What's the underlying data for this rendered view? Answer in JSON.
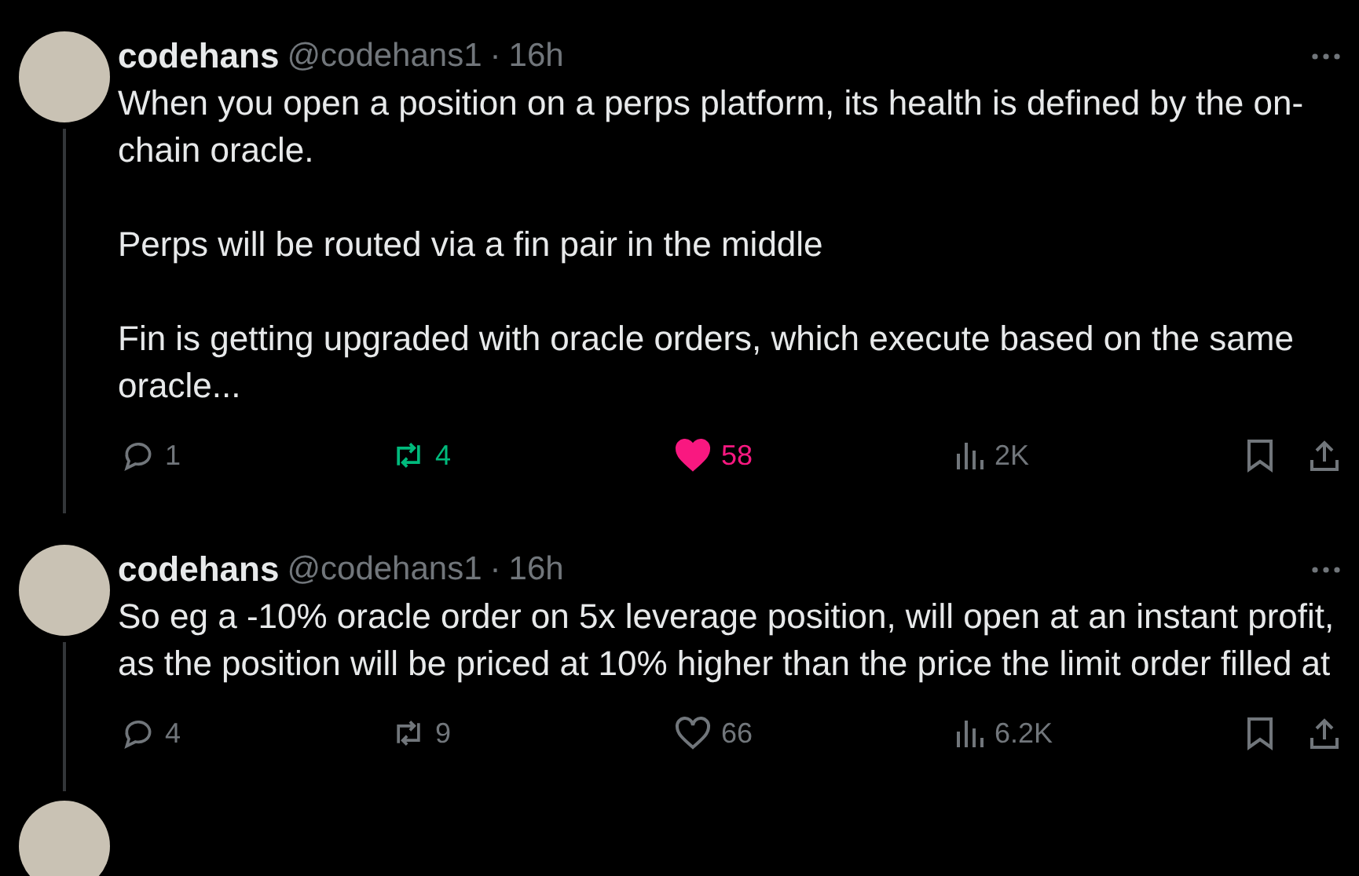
{
  "tweets": [
    {
      "name": "codehans",
      "handle": "@codehans1",
      "separator": "·",
      "time": "16h",
      "paragraphs": [
        "When you open a position on a perps platform, its health is defined by the on-chain oracle.",
        "Perps will be routed via a fin pair in the middle",
        "Fin is getting upgraded with oracle orders, which execute based on the same oracle..."
      ],
      "replies": "1",
      "reposts": "4",
      "reposted": true,
      "likes": "58",
      "liked": true,
      "views": "2K"
    },
    {
      "name": "codehans",
      "handle": "@codehans1",
      "separator": "·",
      "time": "16h",
      "paragraphs": [
        "So eg a -10% oracle order on 5x leverage position, will open at an instant profit, as the position will be priced at 10% higher than the price the limit order filled at"
      ],
      "replies": "4",
      "reposts": "9",
      "reposted": false,
      "likes": "66",
      "liked": false,
      "views": "6.2K"
    }
  ]
}
